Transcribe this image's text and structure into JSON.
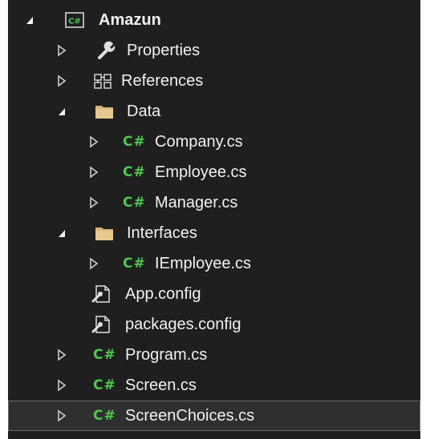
{
  "tree": {
    "project": {
      "label": "Amazun",
      "icon": "csharp-project-icon",
      "expanded": true
    },
    "properties": {
      "label": "Properties",
      "icon": "wrench-icon",
      "expanded": false
    },
    "references": {
      "label": "References",
      "icon": "references-icon",
      "expanded": false
    },
    "data_folder": {
      "label": "Data",
      "icon": "folder-icon",
      "expanded": true
    },
    "company": {
      "label": "Company.cs",
      "icon": "csharp-file-icon",
      "expanded": false
    },
    "employee": {
      "label": "Employee.cs",
      "icon": "csharp-file-icon",
      "expanded": false
    },
    "manager": {
      "label": "Manager.cs",
      "icon": "csharp-file-icon",
      "expanded": false
    },
    "interfaces_folder": {
      "label": "Interfaces",
      "icon": "folder-icon",
      "expanded": true
    },
    "iemployee": {
      "label": "IEmployee.cs",
      "icon": "csharp-file-icon",
      "expanded": false
    },
    "app_config": {
      "label": "App.config",
      "icon": "config-file-icon"
    },
    "packages_config": {
      "label": "packages.config",
      "icon": "config-file-icon"
    },
    "program": {
      "label": "Program.cs",
      "icon": "csharp-file-icon",
      "expanded": false
    },
    "screen": {
      "label": "Screen.cs",
      "icon": "csharp-file-icon",
      "expanded": false
    },
    "screen_choices": {
      "label": "ScreenChoices.cs",
      "icon": "csharp-file-icon",
      "expanded": false,
      "selected": true
    }
  },
  "glyphs": {
    "csharp": "C#",
    "csharp_small": "C#"
  },
  "colors": {
    "background": "#1f1f1f",
    "text": "#f1f1f1",
    "csharp_green": "#4ec94e",
    "folder": "#dcb67a",
    "selection_bg": "#2f2f2f",
    "selection_border": "#6a6a6a"
  }
}
